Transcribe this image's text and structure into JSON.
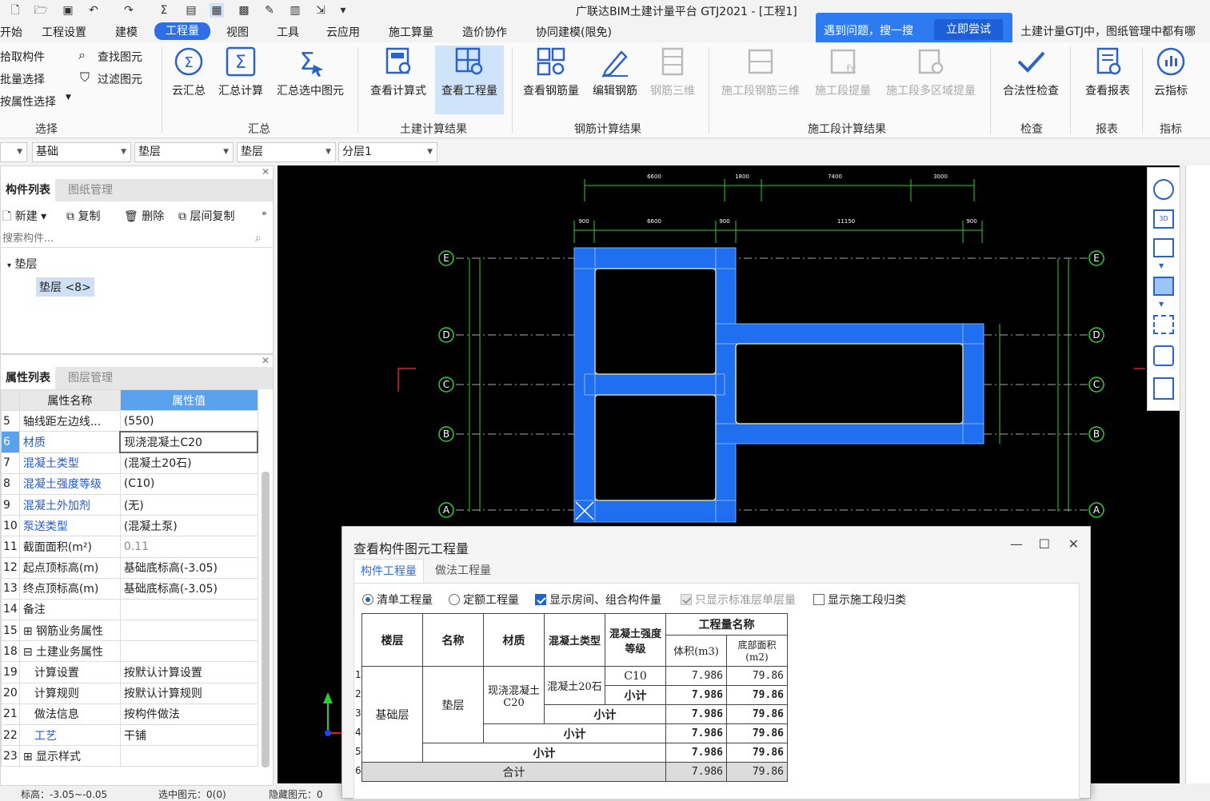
{
  "app": {
    "title": "广联达BIM土建计量平台 GTJ2021 - [工程1]"
  },
  "menu": [
    "开始",
    "工程设置",
    "建模",
    "工程量",
    "视图",
    "工具",
    "云应用",
    "施工算量",
    "造价协作",
    "协同建模(限免)"
  ],
  "popup": {
    "text": "遇到问题，搜一搜",
    "button": "立即尝试",
    "tip": "土建计量GTJ中，图纸管理中都有哪"
  },
  "ribbon": {
    "select": {
      "pick": "拾取构件",
      "batch": "批量选择",
      "by_prop": "按属性选择",
      "find": "查找图元",
      "filter": "过滤图元",
      "group": "选择"
    },
    "summary": {
      "cloud": "云汇总",
      "calc": "汇总计算",
      "selected": "汇总选中图元",
      "group": "汇总"
    },
    "civil": {
      "formula": "查看计算式",
      "qty": "查看工程量",
      "group": "土建计算结果"
    },
    "rebar": {
      "view": "查看钢筋量",
      "edit": "编辑钢筋",
      "3d": "钢筋三维",
      "group": "钢筋计算结果"
    },
    "stage": {
      "rebar3d": "施工段钢筋三维",
      "extract": "施工段提量",
      "multi": "施工段多区域提量",
      "group": "施工段计算结果"
    },
    "check": {
      "legal": "合法性检查",
      "group": "检查"
    },
    "report": {
      "view": "查看报表",
      "group": "报表"
    },
    "index": {
      "cloud": "云指标",
      "group": "指标"
    }
  },
  "selectors": [
    "基础",
    "垫层",
    "垫层",
    "分层1"
  ],
  "component_panel": {
    "tabs": [
      "构件列表",
      "图纸管理"
    ],
    "tools": {
      "new": "新建",
      "copy": "复制",
      "delete": "删除",
      "floor_copy": "层间复制"
    },
    "search_placeholder": "搜索构件...",
    "tree_root": "垫层",
    "tree_item": "垫层 <8>"
  },
  "property_panel": {
    "tabs": [
      "属性列表",
      "图层管理"
    ],
    "headers": [
      "属性名称",
      "属性值"
    ],
    "rows": [
      {
        "n": "5",
        "name": "轴线距左边线...",
        "value": "(550)",
        "blue": false
      },
      {
        "n": "6",
        "name": "材质",
        "value": "现浇混凝土C20",
        "blue": true
      },
      {
        "n": "7",
        "name": "混凝土类型",
        "value": "(混凝土20石)",
        "blue": true
      },
      {
        "n": "8",
        "name": "混凝土强度等级",
        "value": "(C10)",
        "blue": true
      },
      {
        "n": "9",
        "name": "混凝土外加剂",
        "value": "(无)",
        "blue": true
      },
      {
        "n": "10",
        "name": "泵送类型",
        "value": "(混凝土泵)",
        "blue": true
      },
      {
        "n": "11",
        "name": "截面面积(m²)",
        "value": "0.11",
        "blue": false
      },
      {
        "n": "12",
        "name": "起点顶标高(m)",
        "value": "基础底标高(-3.05)",
        "blue": false
      },
      {
        "n": "13",
        "name": "终点顶标高(m)",
        "value": "基础底标高(-3.05)",
        "blue": false
      },
      {
        "n": "14",
        "name": "备注",
        "value": "",
        "blue": false
      },
      {
        "n": "15",
        "name": "⊞ 钢筋业务属性",
        "value": "",
        "blue": false
      },
      {
        "n": "18",
        "name": "⊟ 土建业务属性",
        "value": "",
        "blue": false
      },
      {
        "n": "19",
        "name": "　计算设置",
        "value": "按默认计算设置",
        "blue": false
      },
      {
        "n": "20",
        "name": "　计算规则",
        "value": "按默认计算规则",
        "blue": false
      },
      {
        "n": "21",
        "name": "　做法信息",
        "value": "按构件做法",
        "blue": false
      },
      {
        "n": "22",
        "name": "　工艺",
        "value": "干铺",
        "blue": true
      },
      {
        "n": "23",
        "name": "⊞ 显示样式",
        "value": "",
        "blue": false
      }
    ]
  },
  "drawing": {
    "axes": [
      "E",
      "D",
      "C",
      "B",
      "A"
    ],
    "top_dims_outer": [
      "6600",
      "1800",
      "7400",
      "3000"
    ],
    "top_dims_inner": [
      "900",
      "6600",
      "900",
      "11150",
      "900"
    ]
  },
  "dialog": {
    "title": "查看构件图元工程量",
    "tabs": [
      "构件工程量",
      "做法工程量"
    ],
    "options": {
      "qd": "清单工程量",
      "de": "定额工程量",
      "show_room": "显示房间、组合构件量",
      "std_floor": "只显示标准层单层量",
      "show_stage": "显示施工段归类"
    },
    "table": {
      "headers": {
        "floor": "楼层",
        "name": "名称",
        "material": "材质",
        "concrete_type": "混凝土类型",
        "grade": "混凝土强度等级",
        "qty_name": "工程量名称",
        "volume": "体积(m3)",
        "area": "底部面积(m2)"
      },
      "floor": "基础层",
      "name": "垫层",
      "material": "现浇混凝土C20",
      "concrete_type": "混凝土20石",
      "grade": "C10",
      "subtotal": "小计",
      "total": "合计",
      "volume": "7.986",
      "area": "79.86",
      "row_numbers": [
        "1",
        "2",
        "3",
        "4",
        "5",
        "6"
      ]
    }
  },
  "status": {
    "elev": "标高：-3.05~-0.05",
    "selected": "选中图元：0(0)",
    "hidden": "隐藏图元：0"
  }
}
